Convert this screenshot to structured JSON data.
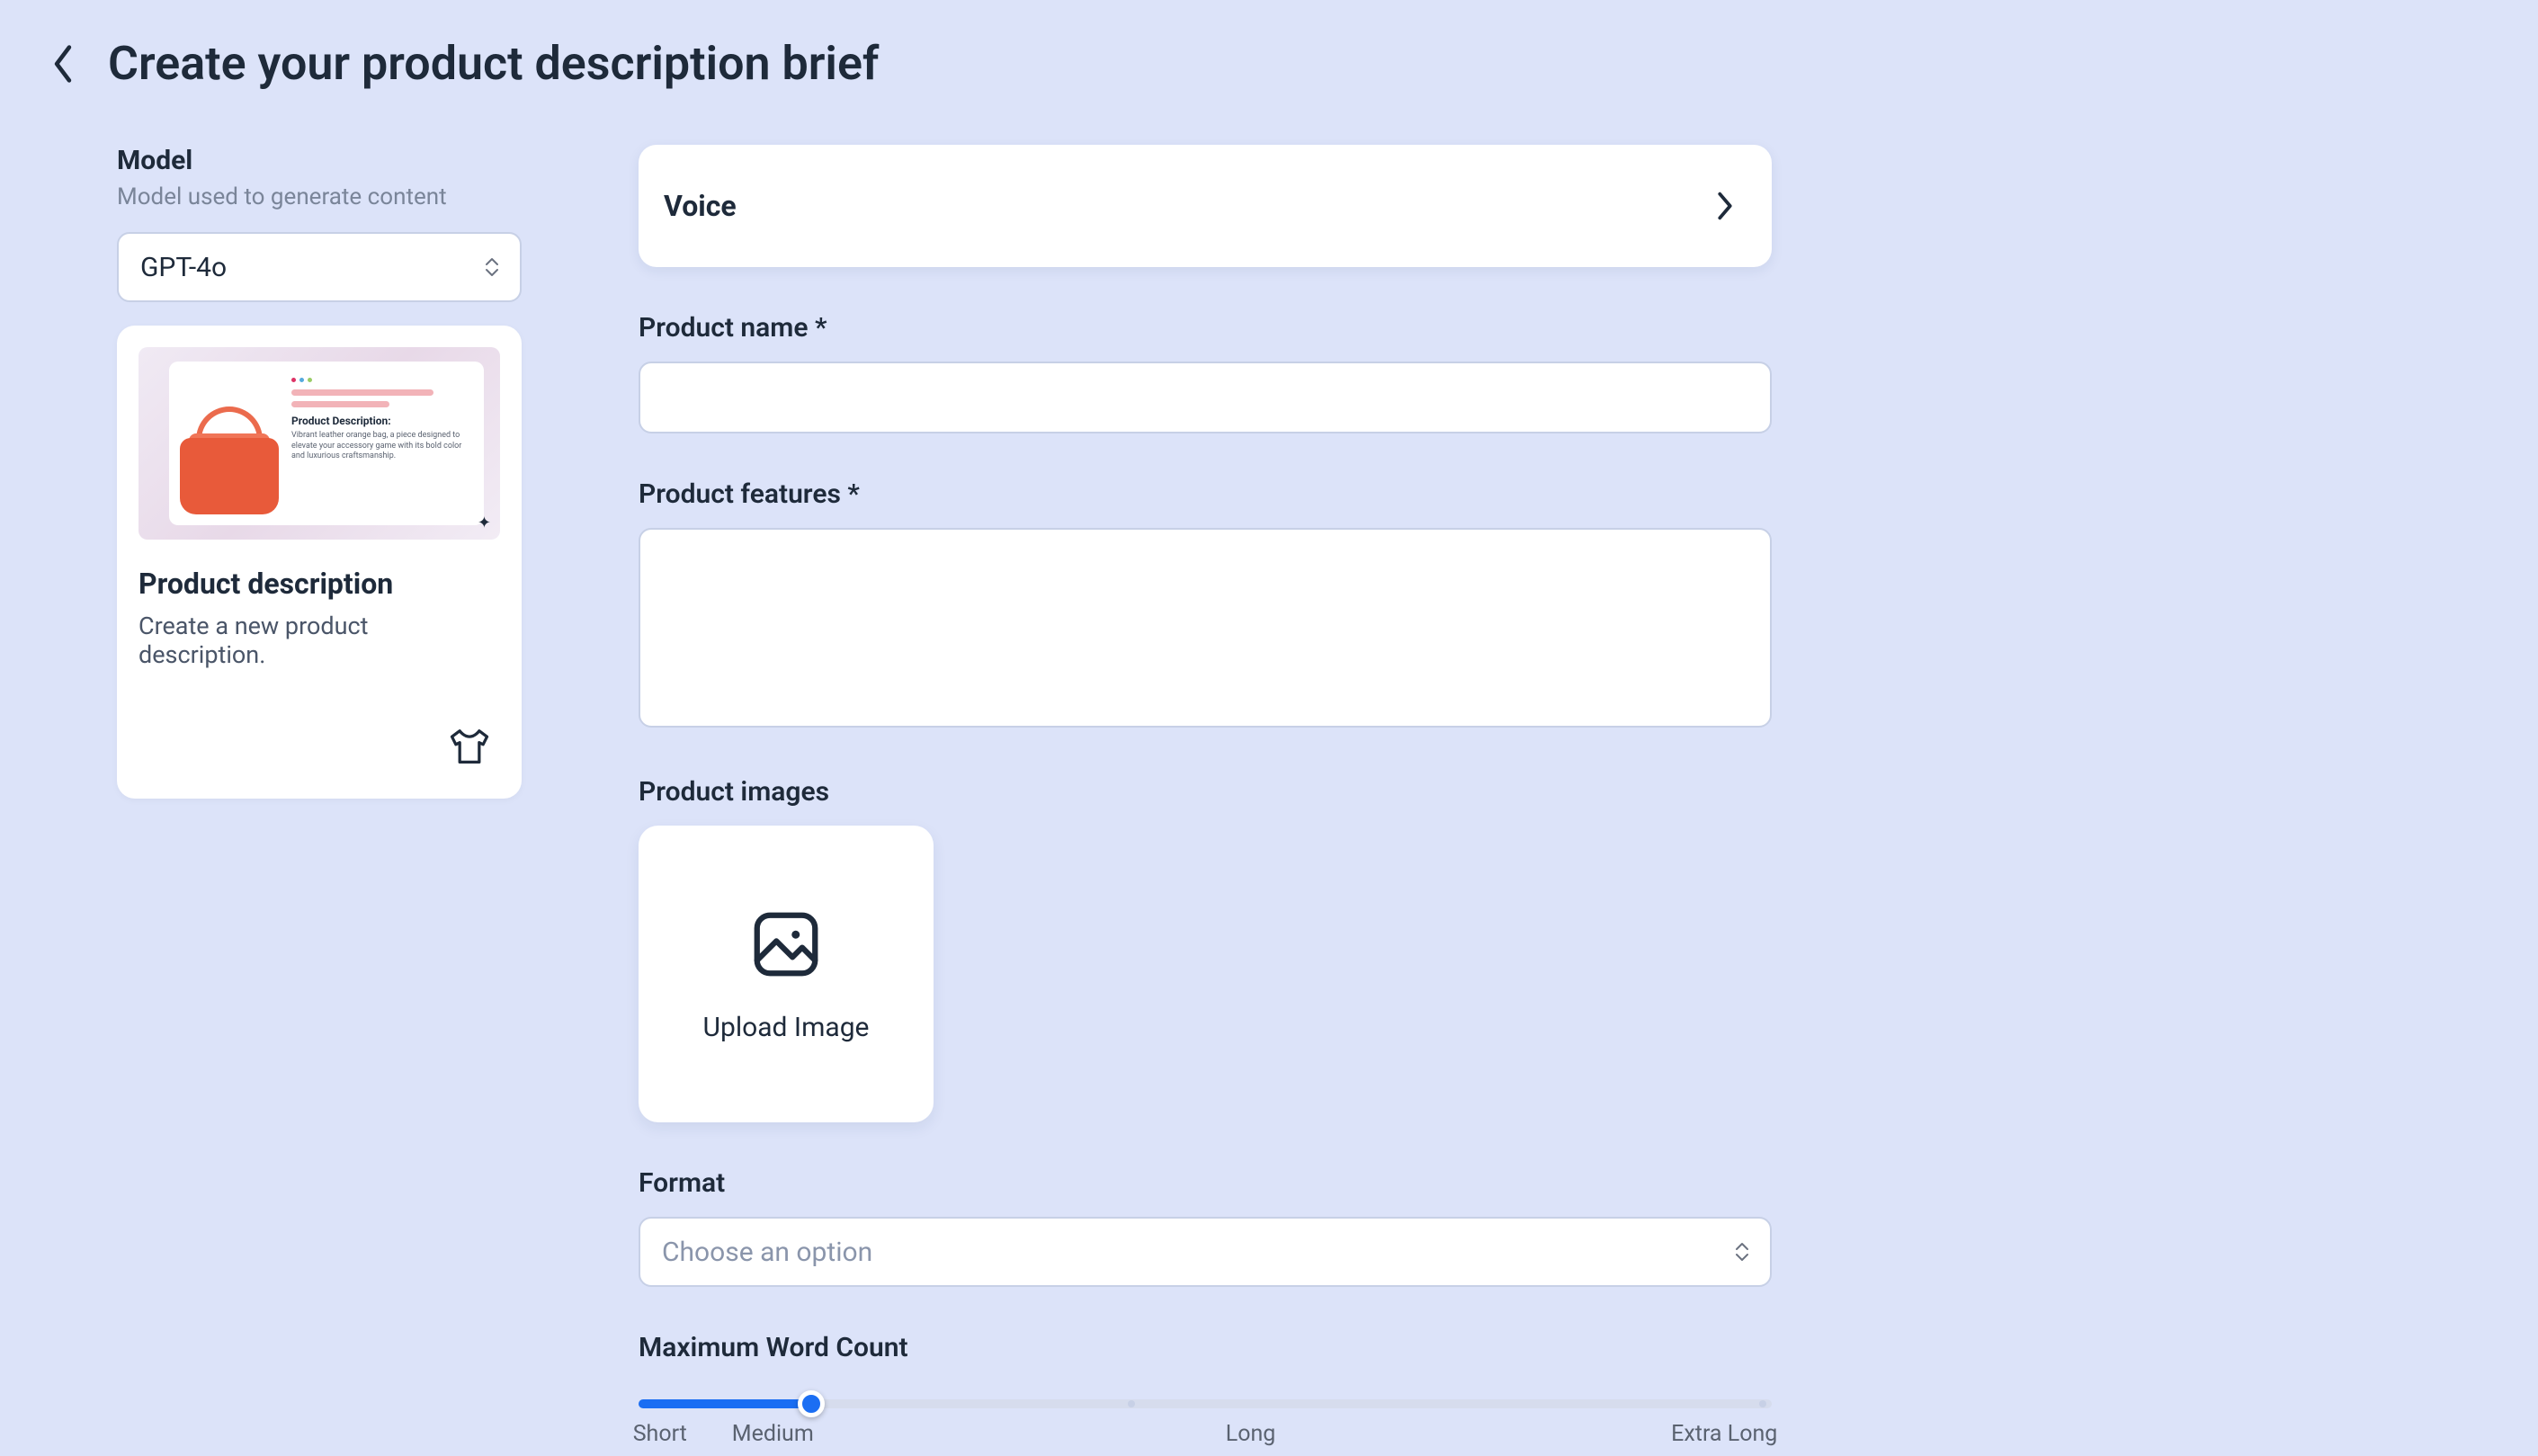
{
  "header": {
    "title": "Create your product description brief"
  },
  "sidebar": {
    "model_label": "Model",
    "model_help": "Model used to generate content",
    "model_value": "GPT-4o",
    "card": {
      "title": "Product description",
      "subtitle": "Create a new product description.",
      "thumb_pd_label": "Product Description:",
      "thumb_pd_body": "Vibrant leather orange bag, a piece designed to elevate your accessory game with its bold color and luxurious craftsmanship."
    }
  },
  "form": {
    "voice_label": "Voice",
    "product_name_label": "Product name *",
    "product_name_value": "",
    "product_features_label": "Product features *",
    "product_features_value": "",
    "product_images_label": "Product images",
    "upload_label": "Upload Image",
    "format_label": "Format",
    "format_placeholder": "Choose an option",
    "wordcount_label": "Maximum Word Count",
    "slider": {
      "labels": [
        "Short",
        "Medium",
        "Long",
        "Extra Long"
      ]
    }
  }
}
